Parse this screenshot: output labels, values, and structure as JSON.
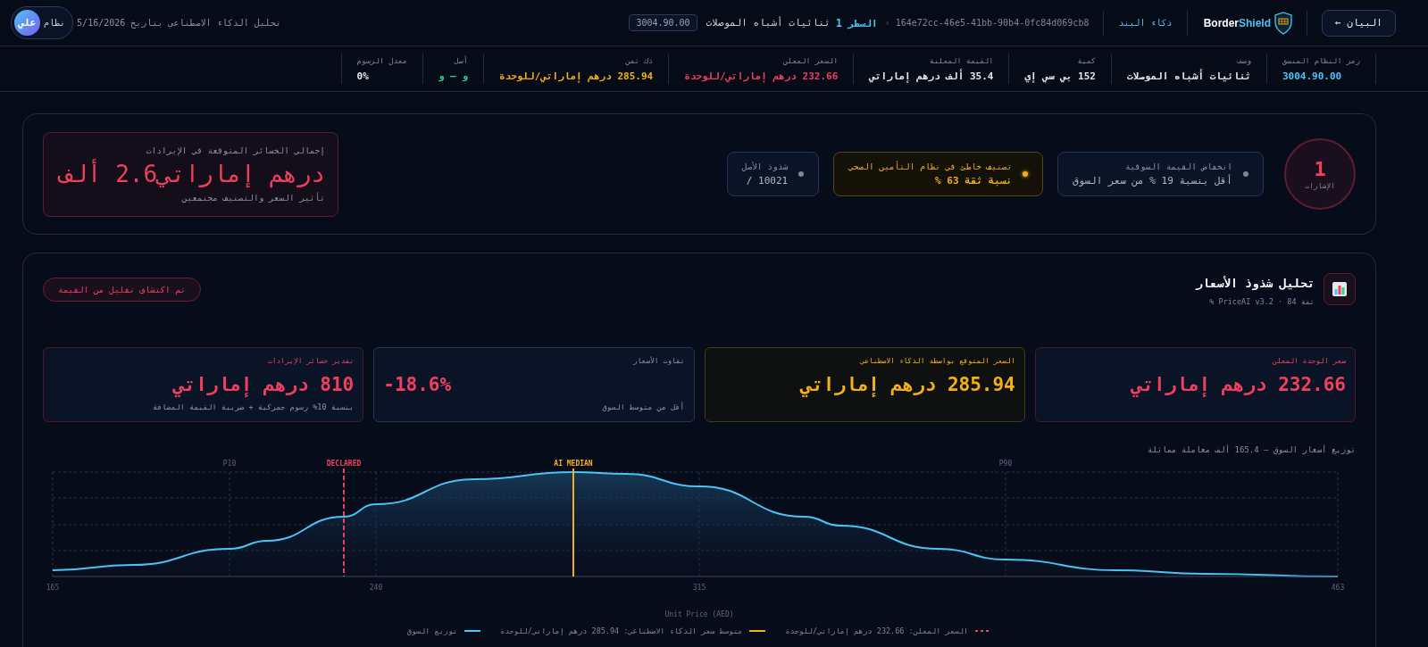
{
  "header": {
    "back_button": "البيان ←",
    "logo": {
      "part_1": "Border",
      "part_2": "Shield"
    },
    "breadcrumb": {
      "section": "ذكاء البند",
      "id": "164e72cc-46e5-41bb-90b4-0fc84d069cb8",
      "separator": "›",
      "line_label": "السطر",
      "line_number": "1",
      "item": "ثنائيات أشباه الموصلات"
    },
    "hs_code": "3004.90.00",
    "analysis_date": "تحليل الذكاء الاصطناعي بتاريخ 5/16/2026",
    "user": {
      "name": "نظام",
      "avatar": "علي"
    }
  },
  "stats": [
    {
      "label": "رمز النظام المنسق",
      "value": "3004.90.00",
      "color": "#4cc3f5"
    },
    {
      "label": "وصف",
      "value": "ثنائيات أشباه الموصلات",
      "color": "#e6e8ef"
    },
    {
      "label": "كمية",
      "value": "152 بي سي إي",
      "color": "#e6e8ef"
    },
    {
      "label": "القيمة المعلنة",
      "value": "35.4 ألف درهم إماراتي",
      "color": "#e6e8ef"
    },
    {
      "label": "السعر المعلن",
      "value": "232.66 درهم إماراتي/للوحدة",
      "color": "#f0405e"
    },
    {
      "label": "ذك ثمن",
      "value": "285.94 درهم إماراتي/للوحدة",
      "color": "#f5b014"
    },
    {
      "label": "أصل",
      "value": "و — و",
      "color": "#2fd38a"
    },
    {
      "label": "معدل الرسوم",
      "value": "0%",
      "color": "#e6e8ef"
    }
  ],
  "signals": {
    "count": "1",
    "label": "الإشارات",
    "flags": [
      {
        "title": "انخفاض القيمة السوقية",
        "detail": "أقل بنسبة 19 % من سعر السوق",
        "kind": "info"
      },
      {
        "title": "تصنيف خاطئ في نظام التأمين الصحي",
        "detail": "نسبة ثقة 63 %",
        "kind": "warning"
      },
      {
        "title": "شذوذ الأصل",
        "detail": "10021 /",
        "kind": "info"
      }
    ],
    "loss": {
      "label": "إجمالي الخسائر المتوقعة في الإيرادات",
      "value": "درهم إماراتي2.6 ألف",
      "note": "تأثير السعر والتصنيف مجتمعين"
    }
  },
  "analysis": {
    "title": "تحليل شذوذ الأسعار",
    "subtitle": "ثقة PriceAI v3.2 · 84 %",
    "badge": "تم اكتشاف تقليل من القيمة",
    "metrics": [
      {
        "label": "سعر الوحدة المعلن",
        "value": "232.66 درهم إماراتي",
        "kind": "alert"
      },
      {
        "label": "السعر المتوقع بواسطة الذكاء الاصطناعي",
        "value": "285.94 درهم إماراتي",
        "kind": "expected"
      },
      {
        "label": "تفاوت الأسعار",
        "value": "-18.6%",
        "note": "أقل من متوسط السوق",
        "kind": "neutral"
      },
      {
        "label": "تقدير خسائر الإيرادات",
        "value": "810 درهم إماراتي",
        "note": "بنسبة 10% رسوم جمركية + ضريبة القيمة المضافة",
        "kind": "alert"
      }
    ],
    "chart": {
      "title": "توزيع أسعار السوق — 165.4 ألف معاملة مماثلة",
      "markers": [
        {
          "label": "P90",
          "kind": "percentile"
        },
        {
          "label": "AI MEDIAN",
          "kind": "median"
        },
        {
          "label": "DECLARED",
          "kind": "declared"
        },
        {
          "label": "P10",
          "kind": "percentile"
        }
      ],
      "xticks": [
        "463",
        "315",
        "240",
        "165"
      ],
      "xlabel": "Unit Price (AED)",
      "legend": [
        {
          "label": "السعر المعلن: 232.66 درهم إماراتي/للوحدة",
          "kind": "declared"
        },
        {
          "label": "متوسط سعر الذكاء الاصطناعي: 285.94 درهم إماراتي/للوحدة",
          "kind": "median"
        },
        {
          "label": "توزيع السوق",
          "kind": "market"
        }
      ]
    }
  }
}
